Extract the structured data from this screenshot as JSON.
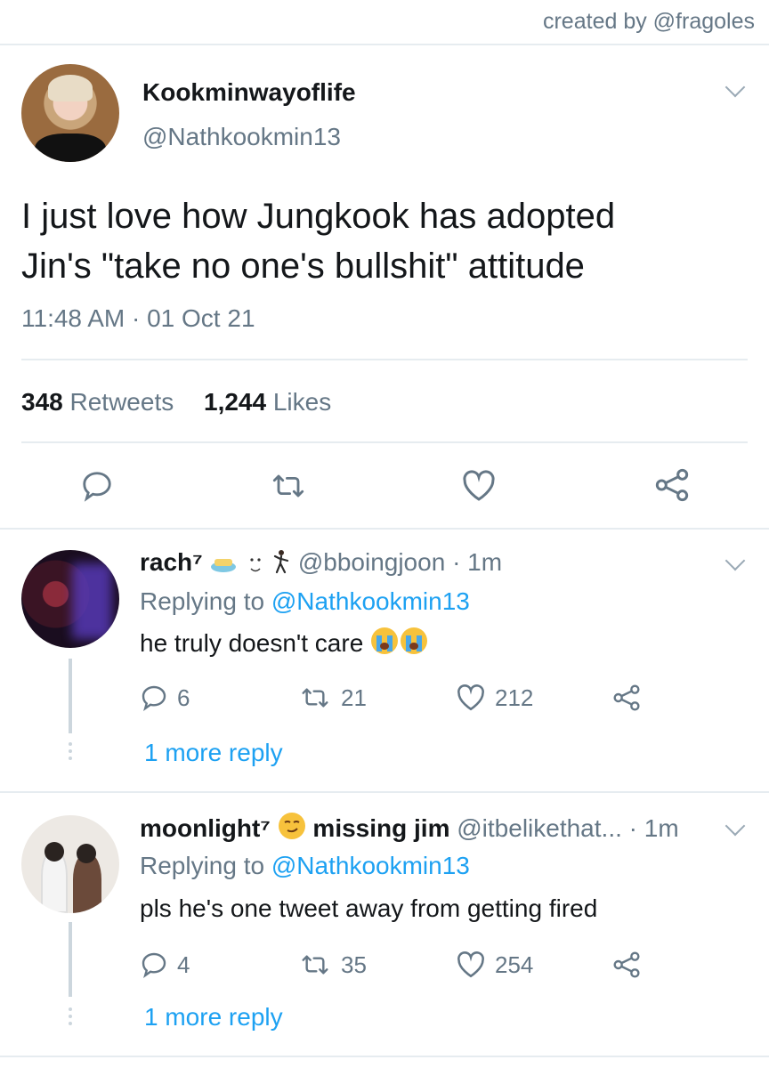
{
  "credit": "created by @fragoles",
  "main_tweet": {
    "name": "Kookminwayoflife",
    "handle": "@Nathkookmin13",
    "text_line1": "I just love how Jungkook has adopted",
    "text_line2": "Jin's \"take no one's bullshit\" attitude",
    "timestamp": "11:48 AM · 01 Oct 21",
    "retweets_count": "348",
    "retweets_label": "Retweets",
    "likes_count": "1,244",
    "likes_label": "Likes",
    "actions": [
      "reply-icon",
      "retweet-icon",
      "like-icon",
      "share-icon"
    ]
  },
  "replies": [
    {
      "name": "rach⁷",
      "handle": "@bboingjoon",
      "time": "· 1m",
      "replying_prefix": "Replying to",
      "replying_to": "@Nathkookmin13",
      "text": "he truly doesn't care",
      "reply_count": "6",
      "retweet_count": "21",
      "like_count": "212",
      "more": "1 more reply"
    },
    {
      "name": "moonlight⁷",
      "name_suffix": "missing jim",
      "handle": "@itbelikethat...",
      "time": "· 1m",
      "replying_prefix": "Replying to",
      "replying_to": "@Nathkookmin13",
      "text": "pls he's one tweet away from getting fired",
      "reply_count": "4",
      "retweet_count": "35",
      "like_count": "254",
      "more": "1 more reply"
    }
  ],
  "colors": {
    "text": "#14171a",
    "secondary": "#657786",
    "link": "#1da1f2",
    "divider": "#e6ecf0"
  }
}
